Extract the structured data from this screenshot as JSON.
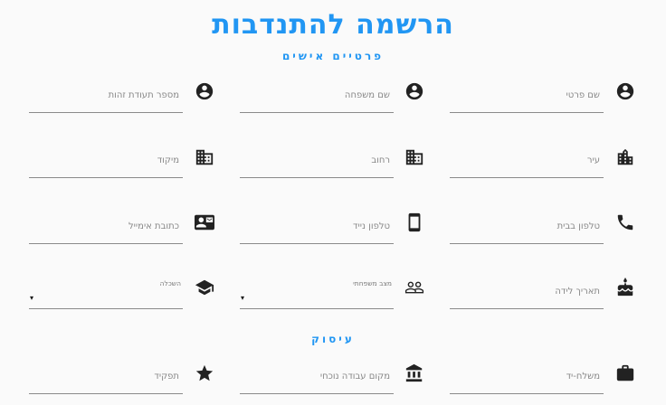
{
  "title": "הרשמה להתנדבות",
  "sections": {
    "personal": "פרטיים אישים",
    "employment": "עיסוק"
  },
  "fields": {
    "first_name": "שם פרטי",
    "last_name": "שם משפחה",
    "id_number": "מספר תעודת זהות",
    "city": "עיר",
    "street": "רחוב",
    "zip": "מיקוד",
    "home_phone": "טלפון בבית",
    "mobile_phone": "טלפון נייד",
    "email": "כתובת אימייל",
    "birth_date": "תאריך לידה",
    "marital_status": "מצב משפחתי",
    "education": "השכלה",
    "occupation": "משלח-יד",
    "workplace": "מקום עבודה נוכחי",
    "role": "תפקיד"
  },
  "select_arrow": "▾",
  "icons": {
    "first_name": "account-circle-icon",
    "last_name": "account-circle-icon",
    "id_number": "account-circle-icon",
    "city": "location-city-icon",
    "street": "business-icon",
    "zip": "business-icon",
    "home_phone": "phone-icon",
    "mobile_phone": "smartphone-icon",
    "email": "contact-mail-icon",
    "birth_date": "cake-icon",
    "marital_status": "people-outline-icon",
    "education": "school-icon",
    "occupation": "work-icon",
    "workplace": "account-balance-icon",
    "role": "star-icon"
  },
  "colors": {
    "accent": "#2196f3",
    "icon": "#222222",
    "underline": "#8a8a8a",
    "label": "#888888"
  }
}
